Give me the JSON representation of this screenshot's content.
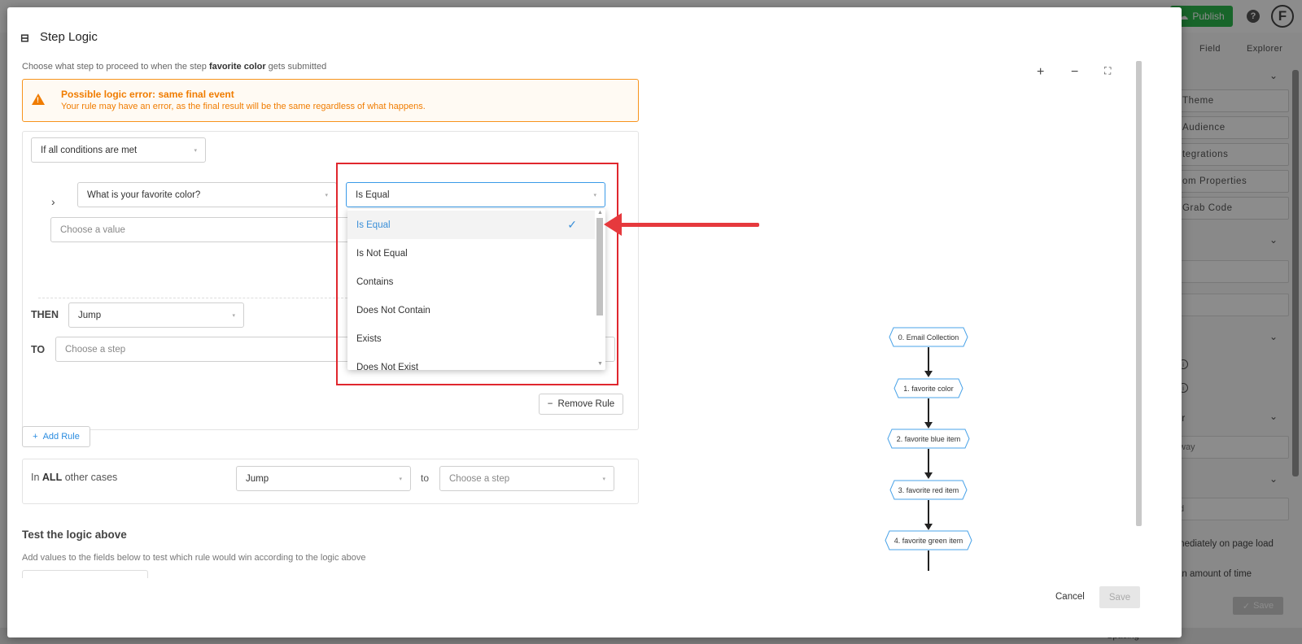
{
  "background": {
    "publish_label": "Publish",
    "help_label": "?",
    "avatar_label": "F",
    "tabs": [
      "Field",
      "Explorer"
    ],
    "panel_buttons": [
      "Theme",
      "Audience",
      "tegrations",
      "om Properties",
      "Grab Code"
    ],
    "input_values": [
      "",
      "",
      "way",
      "d"
    ],
    "texts": [
      "mediately on page load",
      "an amount of time",
      "or"
    ],
    "save_label": "Save",
    "spacing_label": "Spacing",
    "publish_color": "#2db84d"
  },
  "modal": {
    "title": "Step Logic",
    "subtitle_prefix": "Choose what step to proceed to when the step ",
    "subtitle_step": "favorite color",
    "subtitle_suffix": " gets submitted",
    "warning": {
      "title": "Possible logic error: same final event",
      "text": "Your rule may have an error, as the final result will be the same regardless of what happens.",
      "color": "#f07c00"
    },
    "rule": {
      "condition_mode": "If all conditions are met",
      "question": "What is your favorite color?",
      "operator": "Is Equal",
      "value_placeholder": "Choose a value",
      "then_label": "THEN",
      "then_action": "Jump",
      "to_label": "TO",
      "step_placeholder": "Choose a step",
      "remove_label": "Remove Rule"
    },
    "add_rule_label": "Add Rule",
    "other_cases": {
      "prefix": "In ",
      "all": "ALL",
      "suffix": " other cases",
      "action": "Jump",
      "to_label": "to",
      "step_placeholder": "Choose a step"
    },
    "test": {
      "title": "Test the logic above",
      "subtitle": "Add values to the fields below to test which rule would win according to the logic above"
    },
    "dropdown_options": [
      "Is Equal",
      "Is Not Equal",
      "Contains",
      "Does Not Contain",
      "Exists",
      "Does Not Exist"
    ],
    "selected_option": "Is Equal",
    "flow_nodes": [
      "0. Email Collection",
      "1. favorite color",
      "2. favorite blue item",
      "3. favorite red item",
      "4. favorite green item"
    ],
    "zoom_controls": [
      "+",
      "−",
      "⛶"
    ],
    "cancel_label": "Cancel",
    "save_label": "Save",
    "accent_color": "#3a9ae8",
    "annotation_color": "#e0272e"
  }
}
